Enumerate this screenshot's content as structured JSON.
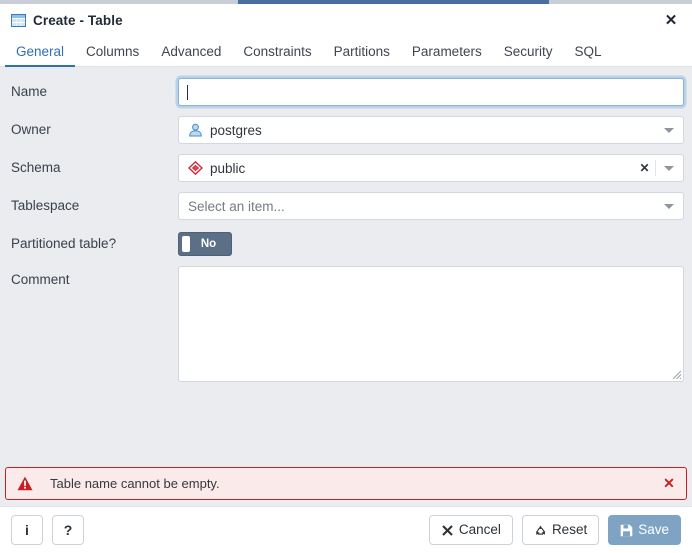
{
  "window": {
    "title": "Create - Table",
    "title_icon": "table-icon",
    "close_label": "✕"
  },
  "tabs": [
    {
      "label": "General",
      "active": true
    },
    {
      "label": "Columns",
      "active": false
    },
    {
      "label": "Advanced",
      "active": false
    },
    {
      "label": "Constraints",
      "active": false
    },
    {
      "label": "Partitions",
      "active": false
    },
    {
      "label": "Parameters",
      "active": false
    },
    {
      "label": "Security",
      "active": false
    },
    {
      "label": "SQL",
      "active": false
    }
  ],
  "form": {
    "name": {
      "label": "Name",
      "value": "",
      "placeholder": "",
      "focused": true
    },
    "owner": {
      "label": "Owner",
      "value": "postgres",
      "icon": "user-icon",
      "caret": "chevron-down-icon"
    },
    "schema": {
      "label": "Schema",
      "value": "public",
      "icon": "schema-diamond-icon",
      "clear_label": "✕",
      "caret": "chevron-down-icon"
    },
    "tablespace": {
      "label": "Tablespace",
      "value": "",
      "placeholder": "Select an item...",
      "caret": "chevron-down-icon"
    },
    "partitioned": {
      "label": "Partitioned table?",
      "state_label": "No",
      "value": false
    },
    "comment": {
      "label": "Comment",
      "value": "",
      "placeholder": ""
    }
  },
  "error": {
    "icon": "warning-triangle-icon",
    "message": "Table name cannot be empty.",
    "close_label": "✕"
  },
  "footer": {
    "info_label": "i",
    "help_label": "?",
    "cancel_label": "Cancel",
    "reset_label": "Reset",
    "save_label": "Save",
    "cancel_icon": "close-x-icon",
    "reset_icon": "recycle-icon",
    "save_icon": "floppy-save-icon"
  },
  "colors": {
    "accent": "#326fad",
    "body_bg": "#eaecf0",
    "error_border": "#c91f24",
    "error_bg": "#fbeaea",
    "save_disabled_bg": "#7fa3c3",
    "toggle_bg": "#5b6f86"
  }
}
